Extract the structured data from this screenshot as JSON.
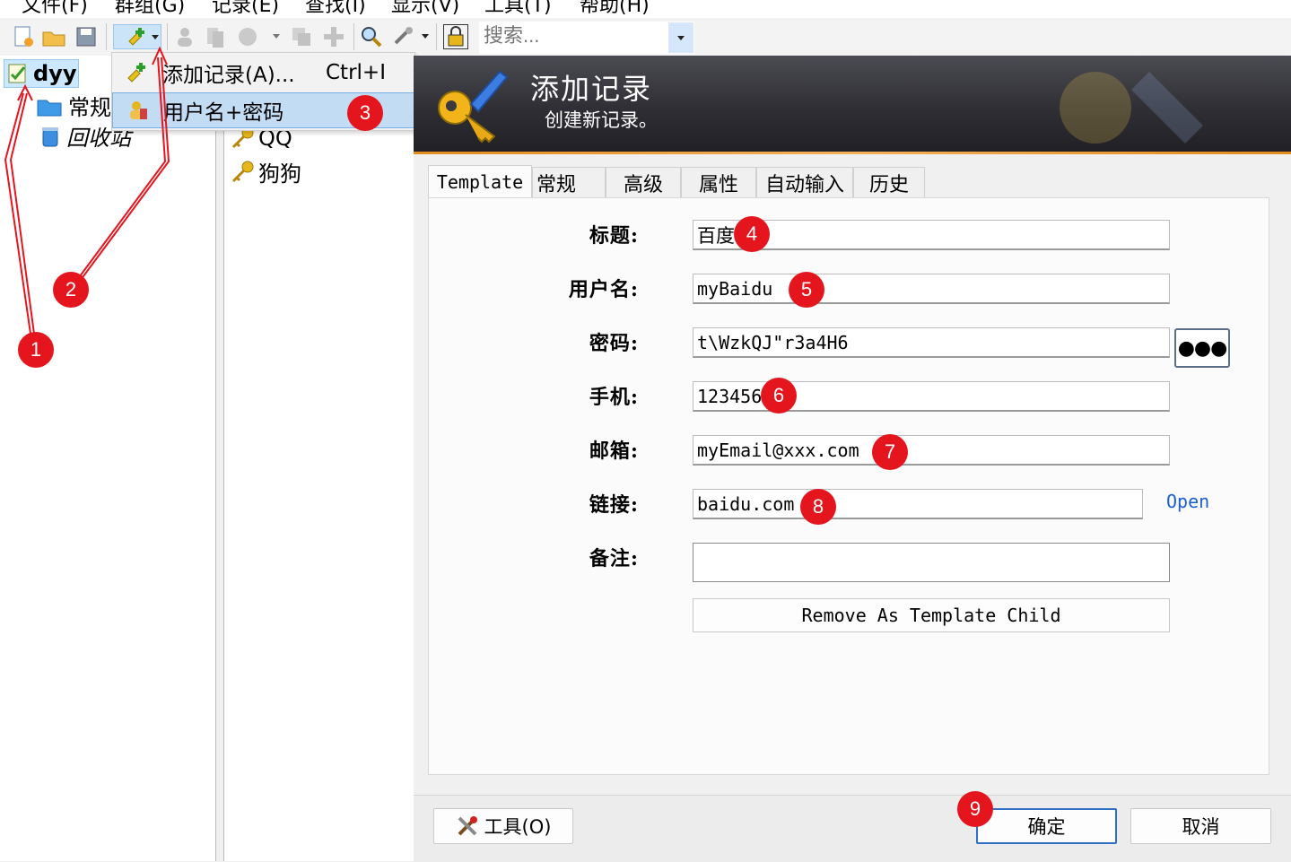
{
  "menubar": {
    "items": [
      "文件(F)",
      "群组(G)",
      "记录(E)",
      "查找(I)",
      "显示(V)",
      "工具(T)",
      "帮助(H)"
    ]
  },
  "toolbar": {
    "search_placeholder": "搜索..."
  },
  "tree": {
    "root_label": "dyy",
    "items": [
      "常规",
      "回收站"
    ]
  },
  "list": {
    "items": [
      "QQ",
      "狗狗"
    ]
  },
  "dropdown": {
    "add_entry_label": "添加记录(A)...",
    "add_entry_shortcut": "Ctrl+I",
    "username_password_label": "用户名+密码"
  },
  "dialog": {
    "banner_title": "添加记录",
    "banner_subtitle": "创建新记录。",
    "tabs": [
      "Template",
      "常规",
      "高级",
      "属性",
      "自动输入",
      "历史"
    ],
    "fields": {
      "title_label": "标题:",
      "title_value": "百度",
      "username_label": "用户名:",
      "username_value": "myBaidu",
      "password_label": "密码:",
      "password_value": "t\\WzkQJ\"r3a4H6",
      "phone_label": "手机:",
      "phone_value": "123456",
      "email_label": "邮箱:",
      "email_value": "myEmail@xxx.com",
      "link_label": "链接:",
      "link_value": "baidu.com",
      "notes_label": "备注:"
    },
    "password_toggle": "●●●",
    "open_link": "Open",
    "remove_template_button": "Remove As Template Child",
    "tools_button": "工具(O)",
    "ok_button": "确定",
    "cancel_button": "取消"
  },
  "annotations": [
    "1",
    "2",
    "3",
    "4",
    "5",
    "6",
    "7",
    "8",
    "9"
  ],
  "colors": {
    "annotation_red": "#e5151e",
    "selection_blue": "#cce8ff",
    "banner_dark": "#2e2e34",
    "link_blue": "#1a5fd0"
  }
}
